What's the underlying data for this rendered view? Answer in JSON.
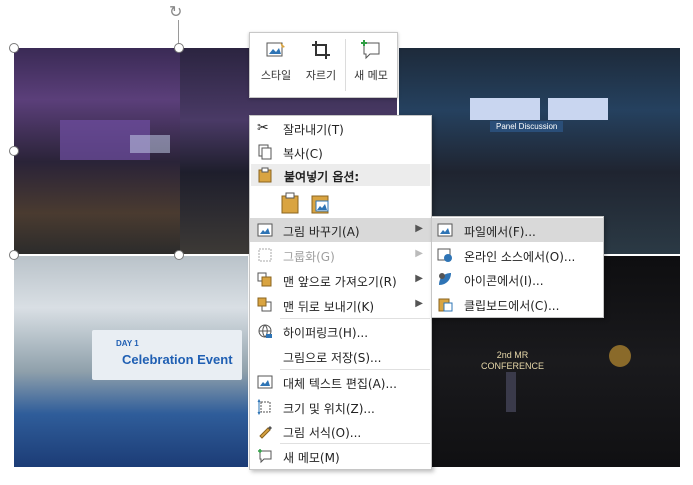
{
  "mini_toolbar": {
    "style_label": "스타일",
    "crop_label": "자르기",
    "new_memo_label": "새 메모"
  },
  "photos": {
    "panel_banner": "Panel Discussion",
    "event_banner_prefix": "DAY 1",
    "event_banner": "Celebration Event",
    "mr_title_line1": "2nd MR",
    "mr_title_line2": "CONFERENCE"
  },
  "context_menu": {
    "cut": "잘라내기(T)",
    "copy": "복사(C)",
    "paste_options": "붙여넣기 옵션:",
    "change_picture": "그림 바꾸기(A)",
    "group": "그룹화(G)",
    "bring_front": "맨 앞으로 가져오기(R)",
    "send_back": "맨 뒤로 보내기(K)",
    "hyperlink": "하이퍼링크(H)...",
    "save_as_picture": "그림으로 저장(S)...",
    "edit_alt_text": "대체 텍스트 편집(A)...",
    "size_position": "크기 및 위치(Z)...",
    "format_picture": "그림 서식(O)...",
    "new_memo": "새 메모(M)"
  },
  "submenu": {
    "from_file": "파일에서(F)...",
    "online_sources": "온라인 소스에서(O)...",
    "from_icons": "아이콘에서(I)...",
    "from_clipboard": "클립보드에서(C)..."
  },
  "colors": {
    "highlight": "#d9d9d9",
    "icon_blue": "#2e74b5",
    "icon_gold": "#d9a441"
  }
}
